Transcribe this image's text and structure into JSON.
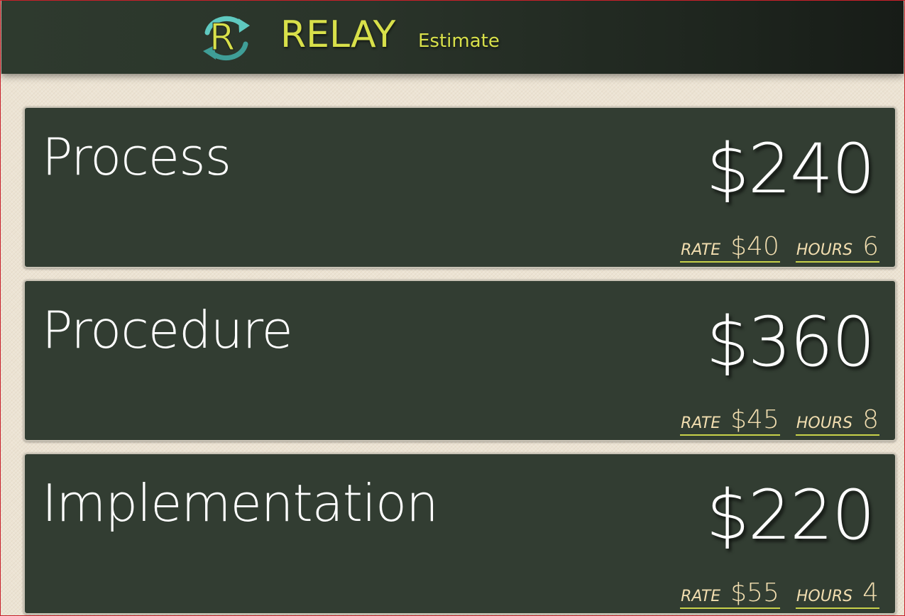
{
  "header": {
    "brand_title": "RELAY",
    "brand_subtitle": "Estimate",
    "logo_letter": "R",
    "accent_color": "#d8e04a",
    "logo_arrow_color": "#5fc9c0"
  },
  "labels": {
    "rate": "RATE",
    "hours": "HOURS"
  },
  "items": [
    {
      "name": "Process",
      "total": "$240",
      "rate": "$40",
      "hours": "6"
    },
    {
      "name": "Procedure",
      "total": "$360",
      "rate": "$45",
      "hours": "8"
    },
    {
      "name": "Implementation",
      "total": "$220",
      "rate": "$55",
      "hours": "4"
    }
  ]
}
